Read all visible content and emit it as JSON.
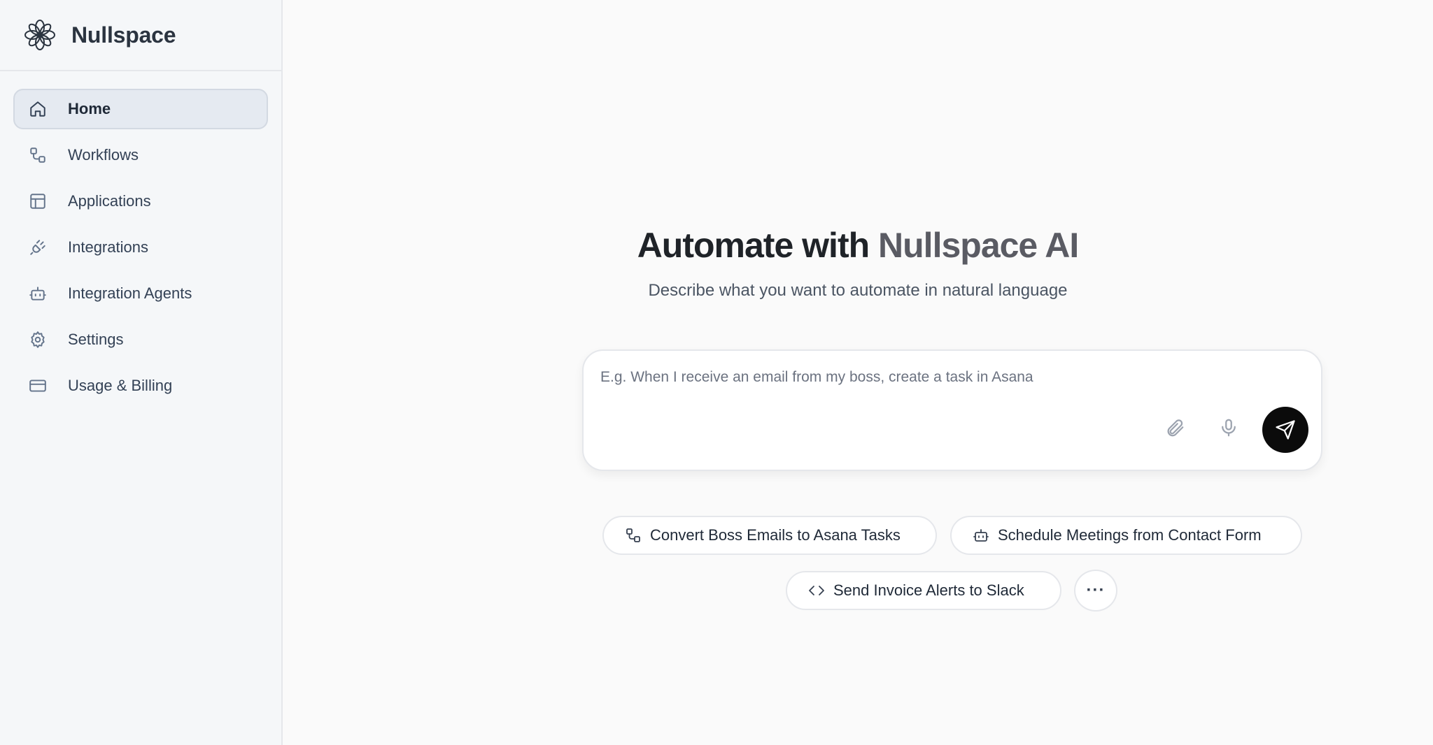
{
  "brand": {
    "name": "Nullspace",
    "logo_icon": "flower-logo-icon"
  },
  "sidebar": {
    "items": [
      {
        "label": "Home",
        "icon": "home-icon",
        "active": true
      },
      {
        "label": "Workflows",
        "icon": "workflow-icon",
        "active": false
      },
      {
        "label": "Applications",
        "icon": "layout-icon",
        "active": false
      },
      {
        "label": "Integrations",
        "icon": "plug-icon",
        "active": false
      },
      {
        "label": "Integration Agents",
        "icon": "bot-icon",
        "active": false
      },
      {
        "label": "Settings",
        "icon": "gear-icon",
        "active": false
      },
      {
        "label": "Usage & Billing",
        "icon": "credit-card-icon",
        "active": false
      }
    ]
  },
  "main": {
    "title_main": "Automate with ",
    "title_accent": "Nullspace AI",
    "subtitle": "Describe what you want to automate in natural language",
    "prompt": {
      "value": "",
      "placeholder": "E.g. When I receive an email from my boss, create a task in Asana"
    },
    "suggestions": [
      {
        "label": "Convert Boss Emails to Asana Tasks",
        "icon": "workflow-icon"
      },
      {
        "label": "Schedule Meetings from Contact Form",
        "icon": "bot-icon"
      },
      {
        "label": "Send Invoice Alerts to Slack",
        "icon": "code-icon"
      }
    ],
    "more_label": "···"
  },
  "colors": {
    "accent": "#0b0b0b",
    "active_nav_bg": "#e5eaf1",
    "title_accent": "#5a5b63"
  }
}
